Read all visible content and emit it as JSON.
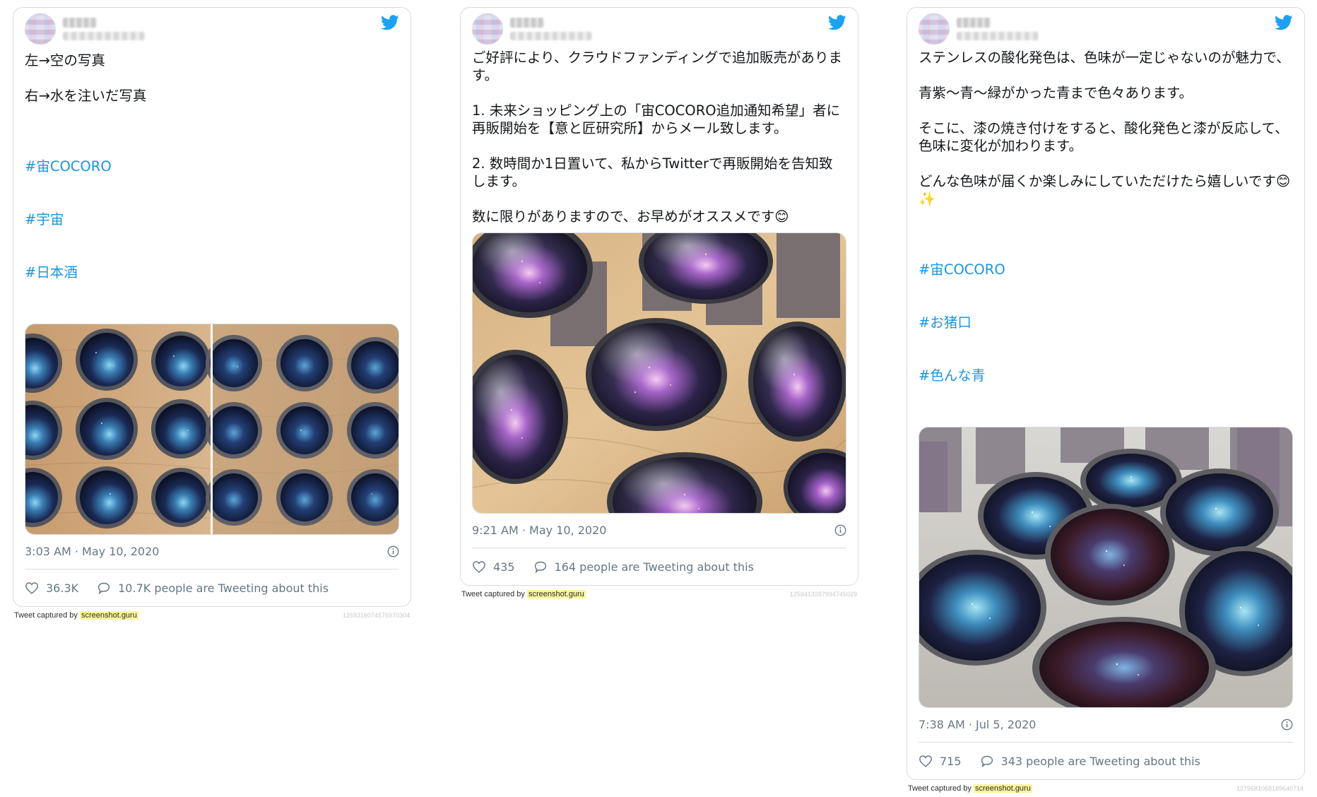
{
  "colors": {
    "accent": "#1b95e0",
    "border": "#d6dce1",
    "muted": "#657786",
    "highlight": "#fbf59a"
  },
  "tweets": [
    {
      "paragraphs": [
        "左→空の写真",
        "右→水を注いだ写真"
      ],
      "hashtags": [
        "#宙COCORO",
        "#宇宙",
        "#日本酒"
      ],
      "timestamp": "3:03 AM · May 10, 2020",
      "likes": "36.3K",
      "discussion": "10.7K people are Tweeting about this",
      "captured_prefix": "Tweet captured by",
      "captured_site": "screenshot.guru",
      "tweet_id": "1259318074575970304"
    },
    {
      "paragraphs": [
        "ご好評により、クラウドファンディングで追加販売がありま\nす。",
        "1. 未来ショッピング上の「宙COCORO追加通知希望」者に\n再販開始を【意と匠研究所】からメール致します。",
        "2. 数時間か1日置いて、私からTwitterで再販開始を告知致\nします。",
        "数に限りがありますので、お早めがオススメです😊"
      ],
      "hashtags": [],
      "timestamp": "9:21 AM · May 10, 2020",
      "likes": "435",
      "discussion": "164 people are Tweeting about this",
      "captured_prefix": "Tweet captured by",
      "captured_site": "screenshot.guru",
      "tweet_id": "1259413287994745029"
    },
    {
      "paragraphs": [
        "ステンレスの酸化発色は、色味が一定じゃないのが魅力で、",
        "青紫〜青〜緑がかった青まで色々あります。",
        "そこに、漆の焼き付けをすると、酸化発色と漆が反応して、\n色味に変化が加わります。",
        "どんな色味が届くか楽しみにしていただけたら嬉しいです😊\n✨"
      ],
      "hashtags": [
        "#宙COCORO",
        "#お猪口",
        "#色んな青"
      ],
      "timestamp": "7:38 AM · Jul 5, 2020",
      "likes": "715",
      "discussion": "343 people are Tweeting about this",
      "captured_prefix": "Tweet captured by",
      "captured_site": "screenshot.guru",
      "tweet_id": "1279681068189640714"
    }
  ]
}
